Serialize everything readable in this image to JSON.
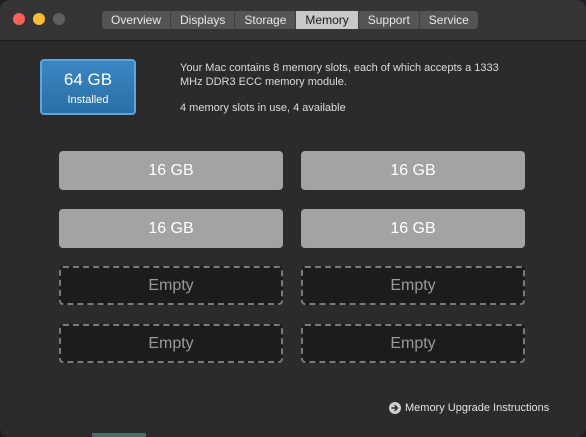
{
  "window": {
    "tabs": [
      {
        "label": "Overview",
        "active": false
      },
      {
        "label": "Displays",
        "active": false
      },
      {
        "label": "Storage",
        "active": false
      },
      {
        "label": "Memory",
        "active": true
      },
      {
        "label": "Support",
        "active": false
      },
      {
        "label": "Service",
        "active": false
      }
    ]
  },
  "summary": {
    "size": "64 GB",
    "status": "Installed",
    "accent_color": "#2f78b5"
  },
  "info": {
    "description": "Your Mac contains 8 memory slots, each of which accepts a 1333 MHz DDR3 ECC memory module.",
    "slots_status": "4 memory slots in use, 4 available"
  },
  "slots": [
    {
      "label": "16 GB",
      "state": "filled"
    },
    {
      "label": "16 GB",
      "state": "filled"
    },
    {
      "label": "16 GB",
      "state": "filled"
    },
    {
      "label": "16 GB",
      "state": "filled"
    },
    {
      "label": "Empty",
      "state": "empty"
    },
    {
      "label": "Empty",
      "state": "empty"
    },
    {
      "label": "Empty",
      "state": "empty"
    },
    {
      "label": "Empty",
      "state": "empty"
    }
  ],
  "footer": {
    "upgrade_link": "Memory Upgrade Instructions",
    "upgrade_icon": "arrow-circle-right-icon"
  }
}
